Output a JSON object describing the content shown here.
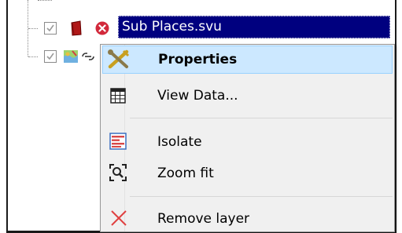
{
  "layers": [
    {
      "name": "Sub Places.svu",
      "checked": true,
      "selected": true,
      "icons": [
        "vector-layer-icon",
        "error-icon"
      ]
    },
    {
      "name": "",
      "checked": true,
      "selected": false,
      "icons": [
        "map-layer-icon",
        "link-icon"
      ]
    }
  ],
  "context_menu": {
    "items": [
      {
        "label": "Properties",
        "icon": "wrench-screwdriver-icon",
        "highlighted": true,
        "bold": true
      },
      {
        "label": "View Data...",
        "icon": "table-icon",
        "highlighted": false,
        "bold": false
      },
      {
        "label": "Isolate",
        "icon": "isolate-layers-icon",
        "highlighted": false,
        "bold": false
      },
      {
        "label": "Zoom fit",
        "icon": "zoom-fit-icon",
        "highlighted": false,
        "bold": false
      },
      {
        "label": "Remove layer",
        "icon": "remove-x-icon",
        "highlighted": false,
        "bold": false
      }
    ]
  },
  "colors": {
    "selection": "#00007f",
    "menu_highlight": "#cce8ff",
    "menu_background": "#f0f0f0",
    "remove_red": "#e04040",
    "properties_gold": "#c8a020"
  }
}
